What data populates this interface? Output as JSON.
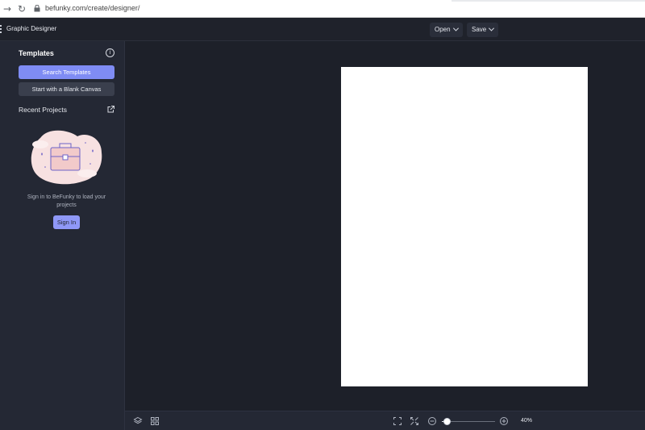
{
  "browser": {
    "url": "befunky.com/create/designer/"
  },
  "header": {
    "title": "Graphic Designer",
    "open_label": "Open",
    "save_label": "Save"
  },
  "sidebar": {
    "templates_heading": "Templates",
    "search_templates_label": "Search Templates",
    "blank_canvas_label": "Start with a Blank Canvas",
    "recent_projects_heading": "Recent Projects",
    "signin_message": "Sign in to BeFunky to load your projects",
    "signin_label": "Sign In"
  },
  "toolbar": {
    "zoom_level": 0.4,
    "zoom_display": "40%"
  },
  "icons": {
    "back": "arrow-right-icon",
    "reload": "reload-icon",
    "lock": "lock-icon",
    "info": "info-icon",
    "external": "external-link-icon",
    "layers": "layers-icon",
    "grid": "grid-icon",
    "fit": "fit-screen-icon",
    "actual": "actual-size-icon",
    "zoom_out": "zoom-out-icon",
    "zoom_in": "zoom-in-icon"
  },
  "colors": {
    "accent": "#7f8cf4",
    "app_bg": "#1f222b",
    "sidebar_bg": "#242834",
    "canvas": "#ffffff"
  }
}
